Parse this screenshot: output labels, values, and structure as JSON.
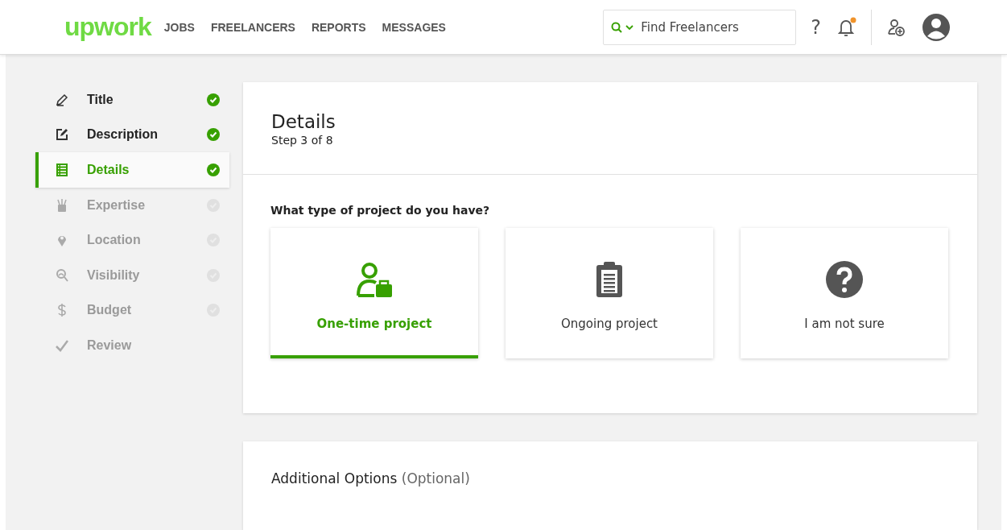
{
  "header": {
    "logo": "upwork",
    "nav": [
      {
        "label": "JOBS"
      },
      {
        "label": "FREELANCERS"
      },
      {
        "label": "REPORTS"
      },
      {
        "label": "MESSAGES"
      }
    ],
    "search": {
      "placeholder": "Find Freelancers"
    },
    "help": "?",
    "notification_unread": true
  },
  "sidebar": {
    "items": [
      {
        "label": "Title",
        "kind": "pencil",
        "completed": true,
        "selected": false
      },
      {
        "label": "Description",
        "kind": "edit",
        "completed": true,
        "selected": false
      },
      {
        "label": "Details",
        "kind": "list",
        "completed": true,
        "selected": true
      },
      {
        "label": "Expertise",
        "kind": "cup",
        "completed": false,
        "selected": false
      },
      {
        "label": "Location",
        "kind": "pin",
        "completed": false,
        "selected": false
      },
      {
        "label": "Visibility",
        "kind": "person-search",
        "completed": false,
        "selected": false
      },
      {
        "label": "Budget",
        "kind": "dollar",
        "completed": false,
        "selected": false
      },
      {
        "label": "Review",
        "kind": "check",
        "completed": false,
        "selected": false
      }
    ]
  },
  "details": {
    "title": "Details",
    "step": "Step 3 of 8",
    "question": "What type of project do you have?",
    "options": [
      {
        "label": "One-time project",
        "kind": "person-briefcase",
        "selected": true
      },
      {
        "label": "Ongoing project",
        "kind": "clipboard",
        "selected": false
      },
      {
        "label": "I am not sure",
        "kind": "question",
        "selected": false
      }
    ]
  },
  "additional": {
    "title": "Additional Options",
    "note": "(Optional)"
  }
}
